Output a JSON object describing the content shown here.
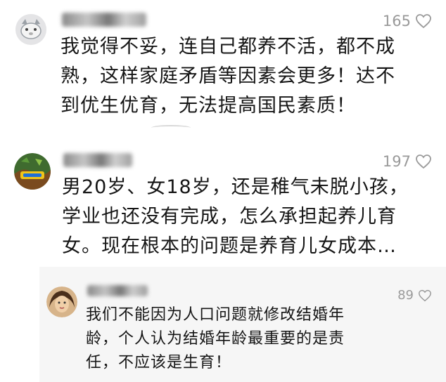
{
  "comments": [
    {
      "likes": "165",
      "text_lines": [
        "我觉得不妥，连自己都养不活，都不成",
        "熟，这样家庭矛盾等因素会更多！达不",
        "到优生优育，无法提高国民素质！"
      ]
    },
    {
      "likes": "197",
      "text_lines": [
        "男20岁、女18岁，还是稚气未脱小孩，",
        "学业也还没有完成，怎么承担起养儿育",
        "女。现在根本的问题是养育儿女成本…"
      ]
    }
  ],
  "reply": {
    "likes": "89",
    "text_lines": [
      "我们不能因为人口问题就修改结婚年",
      "龄，个人认为结婚年龄最重要的是责",
      "任，不应该是生育！"
    ]
  },
  "icons": {
    "like": "heart-outline-icon",
    "avatar1": "cat-avatar-icon",
    "avatar2": "game-logo-avatar-icon",
    "avatar3": "portrait-avatar-icon"
  },
  "colors": {
    "like_count": "#9a9a9a",
    "reply_bg": "#f6f6f6"
  }
}
